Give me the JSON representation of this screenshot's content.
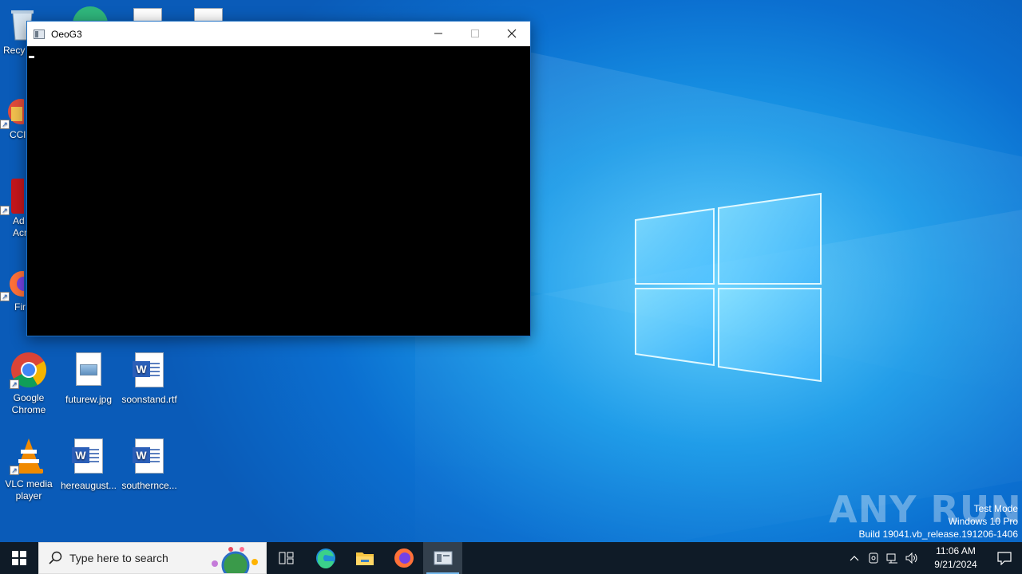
{
  "window": {
    "title": "OeoG3",
    "minimize_label": "—",
    "maximize_label": "□",
    "close_label": "✕"
  },
  "desktop_icons": [
    {
      "label": "Recycle Bin",
      "visible_text": "Recy"
    },
    {
      "label": "CCleaner",
      "visible_text": "CCl"
    },
    {
      "label": "Adobe Acrobat",
      "visible_text": "Ad Acr"
    },
    {
      "label": "Firefox",
      "visible_text": "Fir"
    },
    {
      "label": "Google Chrome"
    },
    {
      "label": "futurew.jpg"
    },
    {
      "label": "soonstand.rtf"
    },
    {
      "label": "VLC media player"
    },
    {
      "label": "hereaugust..."
    },
    {
      "label": "southernce..."
    }
  ],
  "taskbar": {
    "search_placeholder": "Type here to search",
    "apps": [
      "task-view",
      "edge",
      "file-explorer",
      "firefox",
      "console"
    ],
    "time": "11:06 AM",
    "date": "9/21/2024"
  },
  "watermark": {
    "brand": "ANY RUN",
    "test_mode": "Test Mode",
    "edition": "Windows 10 Pro",
    "build": "Build 19041.vb_release.191206-1406"
  },
  "colors": {
    "desktop_blue": "#0b6fd0",
    "taskbar": "#0f1b27",
    "console_bg": "#000000"
  }
}
